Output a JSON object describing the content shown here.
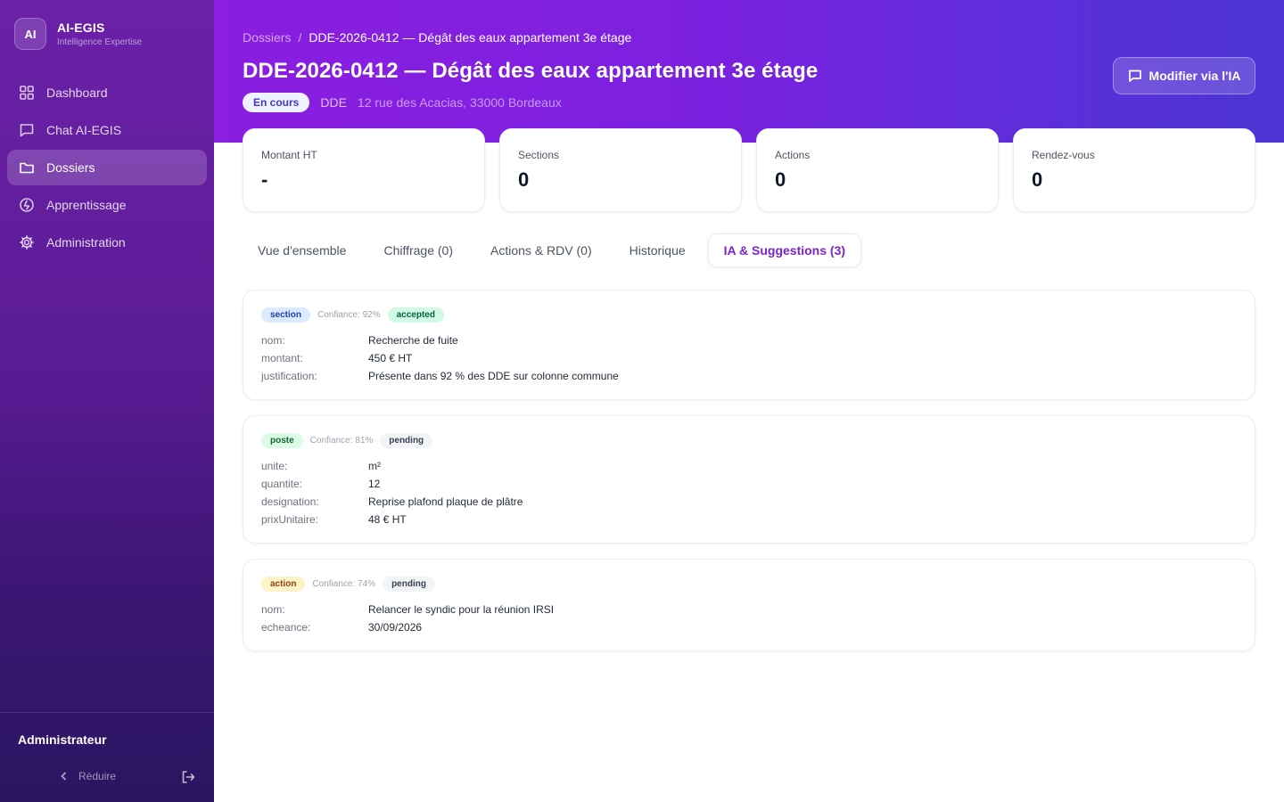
{
  "brand": {
    "logo": "AI",
    "name": "AI-EGIS",
    "subtitle": "Intelligence Expertise"
  },
  "sidebar": {
    "items": [
      {
        "label": "Dashboard",
        "icon": "grid-icon"
      },
      {
        "label": "Chat AI-EGIS",
        "icon": "chat-icon"
      },
      {
        "label": "Dossiers",
        "icon": "folder-icon",
        "active": true
      },
      {
        "label": "Apprentissage",
        "icon": "learning-icon"
      },
      {
        "label": "Administration",
        "icon": "gear-icon"
      }
    ],
    "user": "Administrateur",
    "collapse_label": "Réduire"
  },
  "header": {
    "breadcrumb": {
      "root": "Dossiers",
      "separator": "/",
      "current": "DDE-2026-0412 — Dégât des eaux appartement 3e étage"
    },
    "title": "DDE-2026-0412 — Dégât des eaux appartement 3e étage",
    "status": "En cours",
    "type": "DDE",
    "address": "12 rue des Acacias, 33000 Bordeaux",
    "ia_button": "Modifier via l'IA"
  },
  "stats": [
    {
      "label": "Montant HT",
      "value": "-"
    },
    {
      "label": "Sections",
      "value": "0"
    },
    {
      "label": "Actions",
      "value": "0"
    },
    {
      "label": "Rendez-vous",
      "value": "0"
    }
  ],
  "tabs": [
    {
      "label": "Vue d'ensemble"
    },
    {
      "label": "Chiffrage (0)"
    },
    {
      "label": "Actions & RDV (0)"
    },
    {
      "label": "Historique"
    },
    {
      "label": "IA & Suggestions (3)",
      "active": true
    }
  ],
  "suggestions": [
    {
      "kind": "section",
      "confidence": "Confiance: 92%",
      "status": "accepted",
      "fields": [
        {
          "key": "nom:",
          "value": "Recherche de fuite"
        },
        {
          "key": "montant:",
          "value": "450 € HT"
        },
        {
          "key": "justification:",
          "value": "Présente dans 92 % des DDE sur colonne commune"
        }
      ]
    },
    {
      "kind": "poste",
      "confidence": "Confiance: 81%",
      "status": "pending",
      "fields": [
        {
          "key": "unite:",
          "value": "m²"
        },
        {
          "key": "quantite:",
          "value": "12"
        },
        {
          "key": "designation:",
          "value": "Reprise plafond plaque de plâtre"
        },
        {
          "key": "prixUnitaire:",
          "value": "48 € HT"
        }
      ]
    },
    {
      "kind": "action",
      "confidence": "Confiance: 74%",
      "status": "pending",
      "fields": [
        {
          "key": "nom:",
          "value": "Relancer le syndic pour la réunion IRSI"
        },
        {
          "key": "echeance:",
          "value": "30/09/2026"
        }
      ]
    }
  ],
  "colors": {
    "sidebar_top": "#6b21a8",
    "sidebar_bottom": "#2a1560",
    "header_start": "#8b1ee0",
    "header_end": "#4c35d3",
    "accent": "#7e22ce"
  }
}
